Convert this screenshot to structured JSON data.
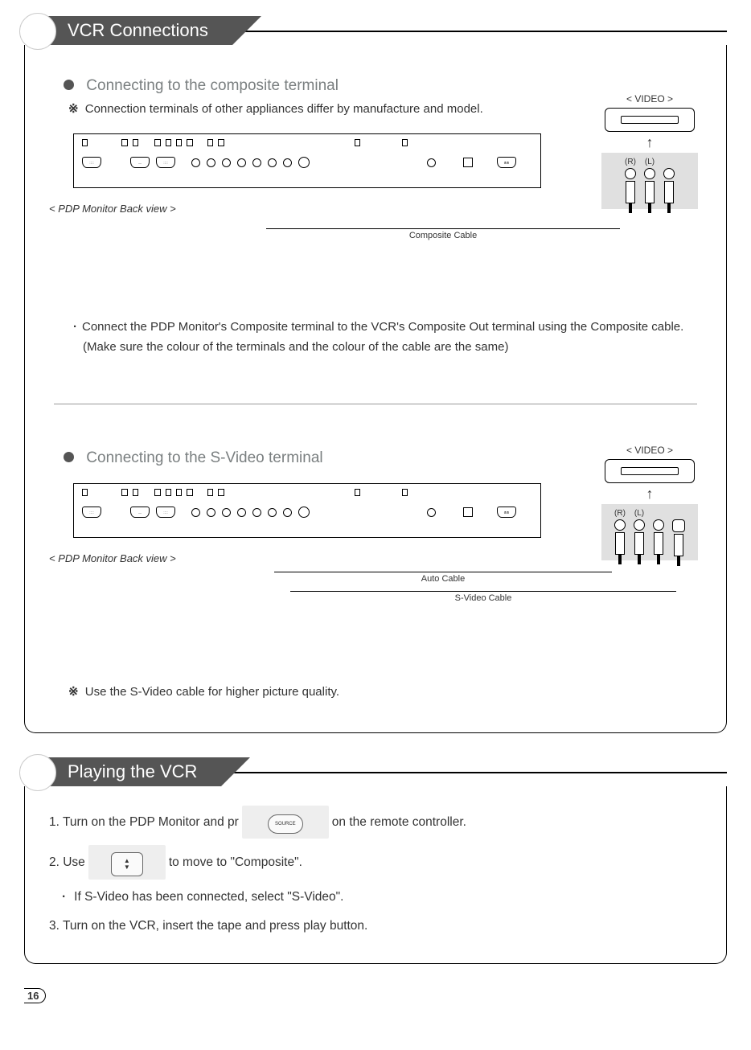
{
  "section1": {
    "title": "VCR Connections",
    "sub1": {
      "heading": "Connecting to the composite terminal",
      "note": "Connection terminals of other appliances differ by manufacture and model.",
      "pdp_label": "< PDP Monitor Back view >",
      "vcr_label": "< VIDEO >",
      "jack_r": "(R)",
      "jack_l": "(L)",
      "cable_label": "Composite Cable",
      "instr1": "Connect the PDP Monitor's Composite terminal to the VCR's Composite Out terminal using the Composite cable.",
      "instr2": "(Make sure the colour of the terminals and the colour of the cable are the same)"
    },
    "sub2": {
      "heading": "Connecting to the S-Video terminal",
      "pdp_label": "< PDP Monitor Back view >",
      "vcr_label": "< VIDEO >",
      "jack_r": "(R)",
      "jack_l": "(L)",
      "cable_label_1": "Auto Cable",
      "cable_label_2": "S-Video Cable",
      "note": "Use the S-Video cable for higher picture quality."
    }
  },
  "section2": {
    "title": "Playing the VCR",
    "step1a": "1. Turn on the PDP Monitor and pr",
    "step1_btn": "SOURCE",
    "step1b": "on the remote controller.",
    "step2a": "2. Use",
    "step2b": "to move to \"Composite\".",
    "step_sv": "If S-Video has been connected, select \"S-Video\".",
    "step3": "3. Turn on the VCR, insert the tape and press play button."
  },
  "page_number": "16"
}
